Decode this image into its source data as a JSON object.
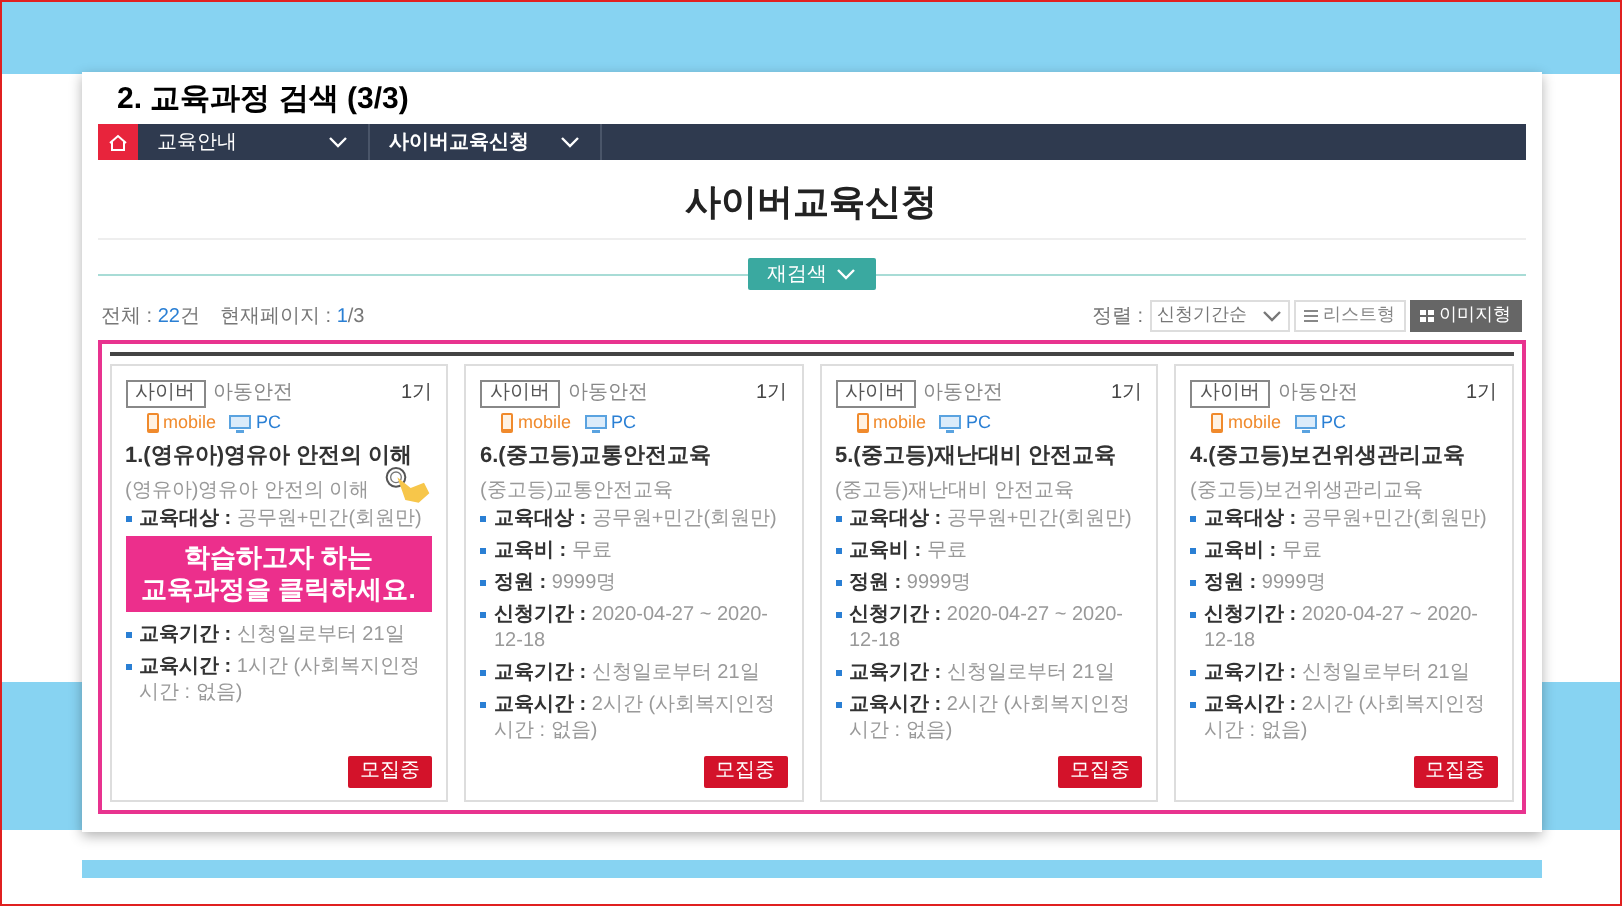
{
  "slide_title": "2. 교육과정 검색 (3/3)",
  "nav": {
    "items": [
      {
        "label": "교육안내"
      },
      {
        "label": "사이버교육신청"
      }
    ]
  },
  "page_title": "사이버교육신청",
  "research_button": "재검색",
  "summary": {
    "total_label": "전체 :",
    "total_value": "22",
    "total_unit": "건",
    "page_label": "현재페이지 :",
    "page_current": "1",
    "page_rest": "/3"
  },
  "sort": {
    "label": "정렬 :",
    "value": "신청기간순"
  },
  "view_buttons": [
    {
      "kind": "list",
      "label": "리스트형",
      "selected": false
    },
    {
      "kind": "grid",
      "label": "이미지형",
      "selected": true
    }
  ],
  "cards": [
    {
      "tag": "사이버",
      "category": "아동안전",
      "term": "1기",
      "platforms": [
        {
          "kind": "mobile",
          "label": "mobile"
        },
        {
          "kind": "pc",
          "label": "PC"
        }
      ],
      "title": "1.(영유아)영유아 안전의 이해",
      "subtitle": "(영유아)영유아 안전의 이해",
      "rows": [
        {
          "label": "교육대상 :",
          "value": "공무원+민간(회원만)"
        },
        {
          "label": "교육기간 :",
          "value": "신청일로부터 21일"
        },
        {
          "label": "교육시간 :",
          "value": "1시간 (사회복지인정시간 : 없음)"
        }
      ],
      "callout": {
        "lines": [
          "학습하고자 하는",
          "교육과정을 클릭하세요."
        ]
      },
      "button": "모집중"
    },
    {
      "tag": "사이버",
      "category": "아동안전",
      "term": "1기",
      "platforms": [
        {
          "kind": "mobile",
          "label": "mobile"
        },
        {
          "kind": "pc",
          "label": "PC"
        }
      ],
      "title": "6.(중고등)교통안전교육",
      "subtitle": "(중고등)교통안전교육",
      "rows": [
        {
          "label": "교육대상 :",
          "value": "공무원+민간(회원만)"
        },
        {
          "label": "교육비 :",
          "value": "무료"
        },
        {
          "label": "정원 :",
          "value": "9999명"
        },
        {
          "label": "신청기간 :",
          "value": "2020-04-27 ~ 2020-12-18"
        },
        {
          "label": "교육기간 :",
          "value": "신청일로부터 21일"
        },
        {
          "label": "교육시간 :",
          "value": "2시간 (사회복지인정시간 : 없음)"
        }
      ],
      "button": "모집중"
    },
    {
      "tag": "사이버",
      "category": "아동안전",
      "term": "1기",
      "platforms": [
        {
          "kind": "mobile",
          "label": "mobile"
        },
        {
          "kind": "pc",
          "label": "PC"
        }
      ],
      "title": "5.(중고등)재난대비 안전교육",
      "subtitle": "(중고등)재난대비 안전교육",
      "rows": [
        {
          "label": "교육대상 :",
          "value": "공무원+민간(회원만)"
        },
        {
          "label": "교육비 :",
          "value": "무료"
        },
        {
          "label": "정원 :",
          "value": "9999명"
        },
        {
          "label": "신청기간 :",
          "value": "2020-04-27 ~ 2020-12-18"
        },
        {
          "label": "교육기간 :",
          "value": "신청일로부터 21일"
        },
        {
          "label": "교육시간 :",
          "value": "2시간 (사회복지인정시간 : 없음)"
        }
      ],
      "button": "모집중"
    },
    {
      "tag": "사이버",
      "category": "아동안전",
      "term": "1기",
      "platforms": [
        {
          "kind": "mobile",
          "label": "mobile"
        },
        {
          "kind": "pc",
          "label": "PC"
        }
      ],
      "title": "4.(중고등)보건위생관리교육",
      "subtitle": "(중고등)보건위생관리교육",
      "rows": [
        {
          "label": "교육대상 :",
          "value": "공무원+민간(회원만)"
        },
        {
          "label": "교육비 :",
          "value": "무료"
        },
        {
          "label": "정원 :",
          "value": "9999명"
        },
        {
          "label": "신청기간 :",
          "value": "2020-04-27 ~ 2020-12-18"
        },
        {
          "label": "교육기간 :",
          "value": "신청일로부터 21일"
        },
        {
          "label": "교육시간 :",
          "value": "2시간 (사회복지인정시간 : 없음)"
        }
      ],
      "button": "모집중"
    }
  ]
}
